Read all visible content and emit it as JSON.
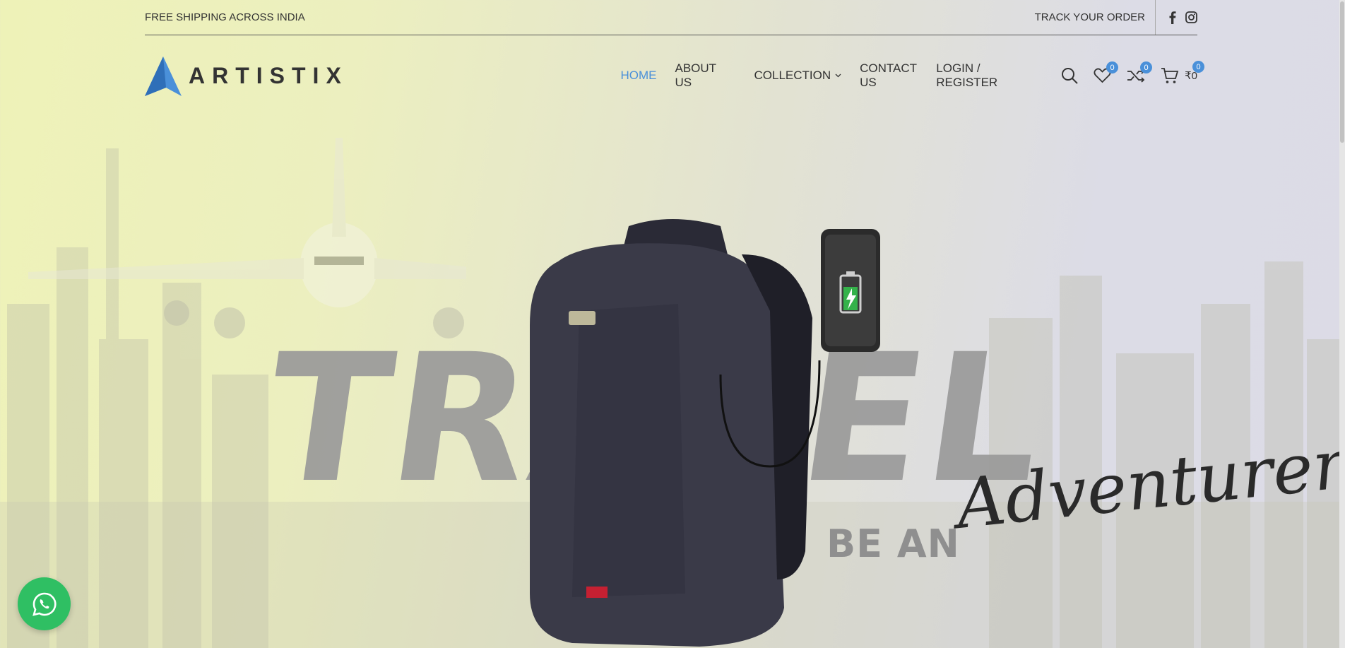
{
  "topbar": {
    "shipping_text": "FREE SHIPPING ACROSS INDIA",
    "track_order": "TRACK YOUR ORDER"
  },
  "logo": {
    "text": "ARTISTIX"
  },
  "menu": {
    "items": [
      {
        "label": "HOME",
        "active": true
      },
      {
        "label": "ABOUT US",
        "active": false
      },
      {
        "label": "COLLECTION",
        "active": false,
        "has_dropdown": true
      },
      {
        "label": "CONTACT US",
        "active": false
      }
    ]
  },
  "header_right": {
    "login_label": "LOGIN / REGISTER",
    "wishlist_count": "0",
    "compare_count": "0",
    "cart_count": "0",
    "cart_total": "₹0"
  },
  "hero": {
    "headline": "TRAVEL",
    "sub_1": "BE AN",
    "sub_2": "Adventurer"
  },
  "colors": {
    "accent": "#4a90d9",
    "whatsapp": "#2fbf63",
    "headline_gray": "#9a9a9a"
  },
  "icons": [
    "facebook-icon",
    "instagram-icon",
    "search-icon",
    "heart-icon",
    "shuffle-icon",
    "cart-icon",
    "chevron-down-icon",
    "whatsapp-icon"
  ]
}
